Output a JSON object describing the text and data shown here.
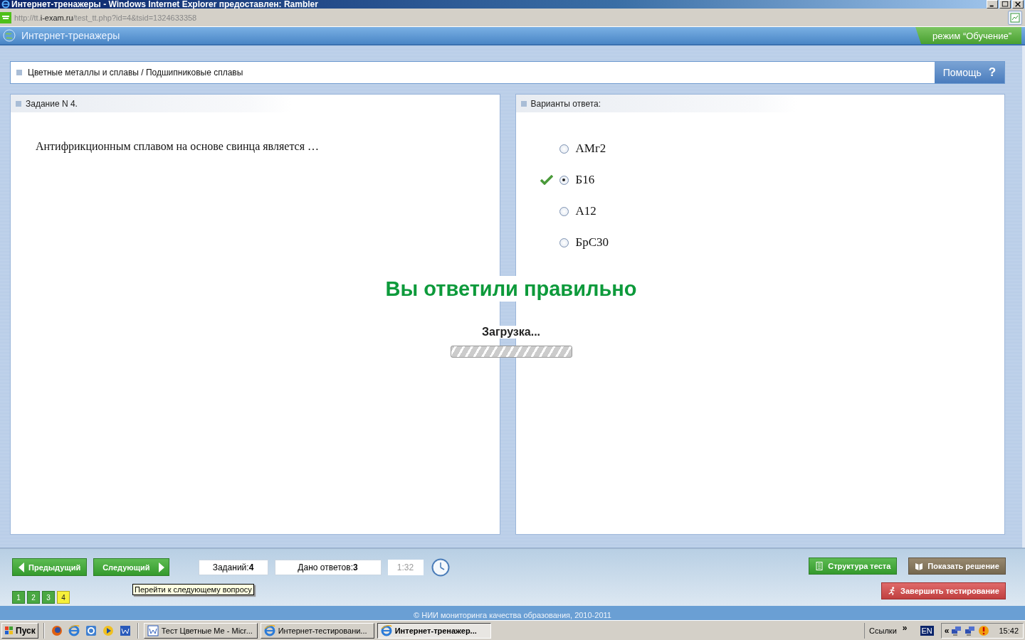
{
  "window": {
    "title": "Интернет-тренажеры - Windows Internet Explorer предоставлен: Rambler"
  },
  "address_bar": {
    "url_prefix": "http://tt.",
    "url_domain": "i-exam.ru",
    "url_path": "/test_tt.php?id=4&tsid=1324633358"
  },
  "app_header": {
    "title": "Интернет-тренажеры",
    "mode": "режим “Обучение”"
  },
  "breadcrumb": {
    "path": "Цветные металлы и сплавы / Подшипниковые сплавы",
    "help_label": "Помощь",
    "help_icon": "?"
  },
  "task_panel": {
    "heading": "Задание N 4.",
    "question": "Антифрикционным сплавом на основе свинца является …"
  },
  "answers_panel": {
    "heading": "Варианты ответа:",
    "options": [
      {
        "label": "АМг2",
        "selected": false,
        "correct": false
      },
      {
        "label": "Б16",
        "selected": true,
        "correct": true
      },
      {
        "label": "А12",
        "selected": false,
        "correct": false
      },
      {
        "label": "БрС30",
        "selected": false,
        "correct": false
      }
    ]
  },
  "overlay": {
    "message": "Вы ответили правильно",
    "loading_label": "Загрузка...",
    "level": 1
  },
  "toolbar": {
    "prev_label": "Предыдущий",
    "next_label": "Следующий",
    "tasks_label": "Заданий:",
    "tasks_value": "4",
    "answers_label": "Дано ответов:",
    "answers_value": "3",
    "timer": "1:32",
    "structure_label": "Структура теста",
    "solution_label": "Показать решение",
    "finish_label": "Завершить тестирование",
    "pages": [
      {
        "label": "1",
        "selected": false
      },
      {
        "label": "2",
        "selected": false
      },
      {
        "label": "3",
        "selected": false
      },
      {
        "label": "4",
        "selected": true
      }
    ]
  },
  "tooltip": {
    "text": "Перейти к следующему вопросу"
  },
  "footer": {
    "copyright": "© НИИ мониторинга качества образования, 2010-2011"
  },
  "taskbar": {
    "start_label": "Пуск",
    "tasks": [
      {
        "label": "Тест Цветные Ме - Micr...",
        "kind": "word",
        "selected": false
      },
      {
        "label": "Интернет-тестировани...",
        "kind": "ie",
        "selected": false
      },
      {
        "label": "Интернет-тренажер...",
        "kind": "ie",
        "selected": true
      }
    ],
    "links_label": "Ссылки",
    "links_chevron": "»",
    "language": "EN",
    "tray_chevron": "«",
    "clock": "15:42"
  }
}
